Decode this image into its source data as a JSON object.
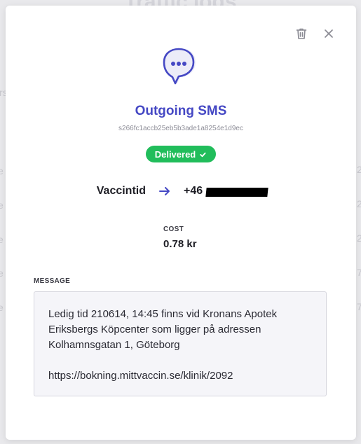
{
  "background": {
    "title": "Traffic logs",
    "left_edge_fragments": [
      "rs",
      "e",
      "e",
      "e",
      "e",
      "e"
    ],
    "right_edge_fragments": [
      "2",
      "2",
      "2",
      "7",
      "7"
    ]
  },
  "modal": {
    "delete_icon": "trash-icon",
    "close_icon": "close-icon",
    "type_icon": "chat-bubble-icon",
    "title": "Outgoing SMS",
    "message_id": "s266fc1accb25eb5b3ade1a8254e1d9ec",
    "status": {
      "label": "Delivered",
      "color": "#21bd5b",
      "icon": "check-icon"
    },
    "sender": "Vaccintid",
    "recipient_visible": "+46",
    "cost_label": "COST",
    "cost_value": "0.78 kr",
    "message_label": "MESSAGE",
    "message_body": "Ledig tid 210614, 14:45 finns vid Kronans Apotek Eriksbergs Köpcenter som ligger på adressen Kolhamnsgatan 1, Göteborg\n\nhttps://bokning.mittvaccin.se/klinik/2092"
  },
  "colors": {
    "accent": "#4548c4",
    "success": "#21bd5b"
  }
}
